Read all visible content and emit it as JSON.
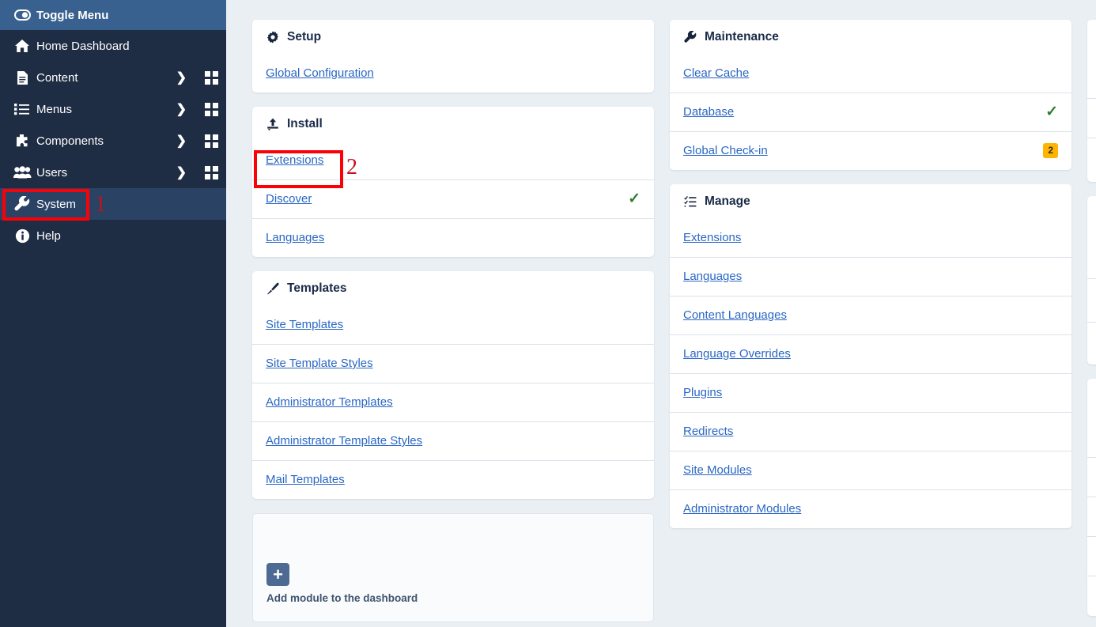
{
  "sidebar": {
    "toggle": {
      "label": "Toggle Menu",
      "icon": "toggle-icon"
    },
    "items": [
      {
        "label": "Home Dashboard",
        "icon": "home-icon",
        "chevron": "",
        "grid": false,
        "active": false
      },
      {
        "label": "Content",
        "icon": "document-icon",
        "chevron": "❯",
        "grid": true,
        "active": false
      },
      {
        "label": "Menus",
        "icon": "list-icon",
        "chevron": "❯",
        "grid": true,
        "active": false
      },
      {
        "label": "Components",
        "icon": "puzzle-icon",
        "chevron": "❯",
        "grid": true,
        "active": false
      },
      {
        "label": "Users",
        "icon": "users-icon",
        "chevron": "❯",
        "grid": true,
        "active": false
      },
      {
        "label": "System",
        "icon": "wrench-icon",
        "chevron": "",
        "grid": false,
        "active": true
      },
      {
        "label": "Help",
        "icon": "info-icon",
        "chevron": "",
        "grid": false,
        "active": false
      }
    ]
  },
  "panels": {
    "setup": {
      "title": "Setup",
      "icon": "gear-icon",
      "links": [
        {
          "label": "Global Configuration",
          "status": "",
          "badge": ""
        }
      ]
    },
    "install": {
      "title": "Install",
      "icon": "upload-icon",
      "links": [
        {
          "label": "Extensions",
          "status": "",
          "badge": ""
        },
        {
          "label": "Discover",
          "status": "check",
          "badge": ""
        },
        {
          "label": "Languages",
          "status": "",
          "badge": ""
        }
      ]
    },
    "templates": {
      "title": "Templates",
      "icon": "paintbrush-icon",
      "links": [
        {
          "label": "Site Templates",
          "status": "",
          "badge": ""
        },
        {
          "label": "Site Template Styles",
          "status": "",
          "badge": ""
        },
        {
          "label": "Administrator Templates",
          "status": "",
          "badge": ""
        },
        {
          "label": "Administrator Template Styles",
          "status": "",
          "badge": ""
        },
        {
          "label": "Mail Templates",
          "status": "",
          "badge": ""
        }
      ]
    },
    "maintenance": {
      "title": "Maintenance",
      "icon": "wrench-icon",
      "links": [
        {
          "label": "Clear Cache",
          "status": "",
          "badge": ""
        },
        {
          "label": "Database",
          "status": "check",
          "badge": ""
        },
        {
          "label": "Global Check-in",
          "status": "",
          "badge": "2"
        }
      ]
    },
    "manage": {
      "title": "Manage",
      "icon": "tasklist-icon",
      "links": [
        {
          "label": "Extensions",
          "status": "",
          "badge": ""
        },
        {
          "label": "Languages",
          "status": "",
          "badge": ""
        },
        {
          "label": "Content Languages",
          "status": "",
          "badge": ""
        },
        {
          "label": "Language Overrides",
          "status": "",
          "badge": ""
        },
        {
          "label": "Plugins",
          "status": "",
          "badge": ""
        },
        {
          "label": "Redirects",
          "status": "",
          "badge": ""
        },
        {
          "label": "Site Modules",
          "status": "",
          "badge": ""
        },
        {
          "label": "Administrator Modules",
          "status": "",
          "badge": ""
        }
      ]
    }
  },
  "add_module": {
    "caption": "Add module to the dashboard",
    "plus": "+"
  },
  "annotations": [
    {
      "number": "1",
      "target": "sidebar-item-system"
    },
    {
      "number": "2",
      "target": "install-link-extensions"
    }
  ],
  "colors": {
    "sidebar_bg": "#1f2d44",
    "sidebar_header": "#39618f",
    "sidebar_active": "#2a4365",
    "page_bg": "#eaeff4",
    "link": "#2a67c4",
    "check": "#2f7d32",
    "badge": "#ffb400",
    "annotation": "#fb0007"
  }
}
